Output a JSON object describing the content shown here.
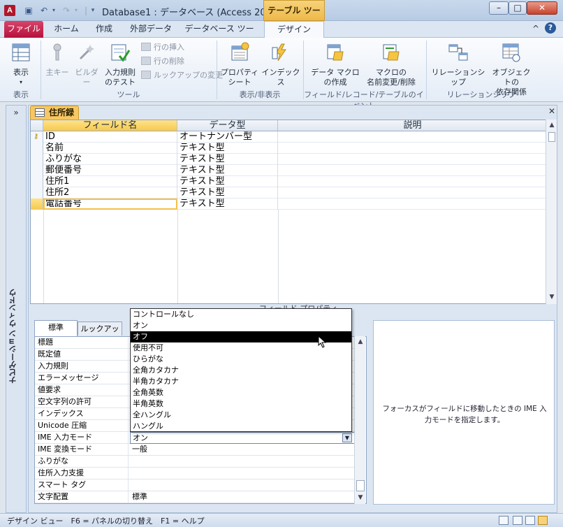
{
  "window": {
    "title": "Database1 : データベース (Access 200...",
    "contextual_tab": "テーブル ツール",
    "controls": [
      "–",
      "□",
      "✕"
    ],
    "app_icon": "A"
  },
  "tabs": [
    "ファイル",
    "ホーム",
    "作成",
    "外部データ",
    "データベース ツール",
    "デザイン"
  ],
  "ribbon": {
    "groups": [
      {
        "label": "表示",
        "buttons": [
          {
            "label": "表示",
            "icon": "view-icon"
          }
        ]
      },
      {
        "label": "ツール",
        "buttons": [
          {
            "label": "主キー",
            "icon": "primary-key-icon",
            "enabled": false
          },
          {
            "label": "ビルダー",
            "icon": "builder-icon",
            "enabled": false
          },
          {
            "label": "入力規則\nのテスト",
            "icon": "validation-test-icon",
            "enabled": true
          },
          {
            "label": "行の挿入",
            "icon": "insert-row-icon",
            "enabled": false
          },
          {
            "label": "行の削除",
            "icon": "delete-row-icon",
            "enabled": false
          },
          {
            "label": "ルックアップの変更",
            "icon": "lookup-change-icon",
            "enabled": false
          }
        ]
      },
      {
        "label": "表示/非表示",
        "buttons": [
          {
            "label": "プロパティ\nシート",
            "icon": "property-sheet-icon"
          },
          {
            "label": "インデックス",
            "icon": "indexes-icon"
          }
        ]
      },
      {
        "label": "フィールド/レコード/テーブルのイベント",
        "buttons": [
          {
            "label": "データ マクロ\nの作成",
            "icon": "data-macro-icon"
          },
          {
            "label": "マクロの\n名前変更/削除",
            "icon": "macro-rename-icon"
          }
        ]
      },
      {
        "label": "リレーションシップ",
        "buttons": [
          {
            "label": "リレーションシップ",
            "icon": "relationships-icon"
          },
          {
            "label": "オブジェクトの\n依存関係",
            "icon": "object-dependencies-icon"
          }
        ]
      }
    ]
  },
  "nav": {
    "toggle": "»",
    "label": "ナビゲーション ウィンドウ"
  },
  "document": {
    "tab_label": "住所録",
    "columns": [
      "フィールド名",
      "データ型",
      "説明"
    ],
    "rows": [
      {
        "name": "ID",
        "type": "オートナンバー型",
        "key": true
      },
      {
        "name": "名前",
        "type": "テキスト型"
      },
      {
        "name": "ふりがな",
        "type": "テキスト型"
      },
      {
        "name": "郵便番号",
        "type": "テキスト型"
      },
      {
        "name": "住所1",
        "type": "テキスト型"
      },
      {
        "name": "住所2",
        "type": "テキスト型"
      },
      {
        "name": "電話番号",
        "type": "テキスト型",
        "active": true
      }
    ]
  },
  "field_properties": {
    "title": "フィールド プロパティ",
    "tabs": [
      "標準",
      "ルックアップ"
    ],
    "props": [
      {
        "label": "標題",
        "value": ""
      },
      {
        "label": "既定値",
        "value": ""
      },
      {
        "label": "入力規則",
        "value": ""
      },
      {
        "label": "エラーメッセージ",
        "value": ""
      },
      {
        "label": "値要求",
        "value": ""
      },
      {
        "label": "空文字列の許可",
        "value": ""
      },
      {
        "label": "インデックス",
        "value": ""
      },
      {
        "label": "Unicode 圧縮",
        "value": ""
      },
      {
        "label": "IME 入力モード",
        "value": "オン"
      },
      {
        "label": "IME 変換モード",
        "value": "一般"
      },
      {
        "label": "ふりがな",
        "value": ""
      },
      {
        "label": "住所入力支援",
        "value": ""
      },
      {
        "label": "スマート タグ",
        "value": ""
      },
      {
        "label": "文字配置",
        "value": "標準"
      }
    ],
    "help_text": "フォーカスがフィールドに移動したときの IME 入力モードを指定します。"
  },
  "ime_dropdown": {
    "options": [
      "コントロールなし",
      "オン",
      "オフ",
      "使用不可",
      "ひらがな",
      "全角カタカナ",
      "半角カタカナ",
      "全角英数",
      "半角英数",
      "全ハングル",
      "ハングル"
    ],
    "selected": "オフ"
  },
  "status": {
    "text": "デザイン ビュー　F6 = パネルの切り替え　F1 = ヘルプ"
  },
  "colors": {
    "file_tab": "#b5123d",
    "contextual": "#f6c94f",
    "accent": "#2a5a9a"
  }
}
